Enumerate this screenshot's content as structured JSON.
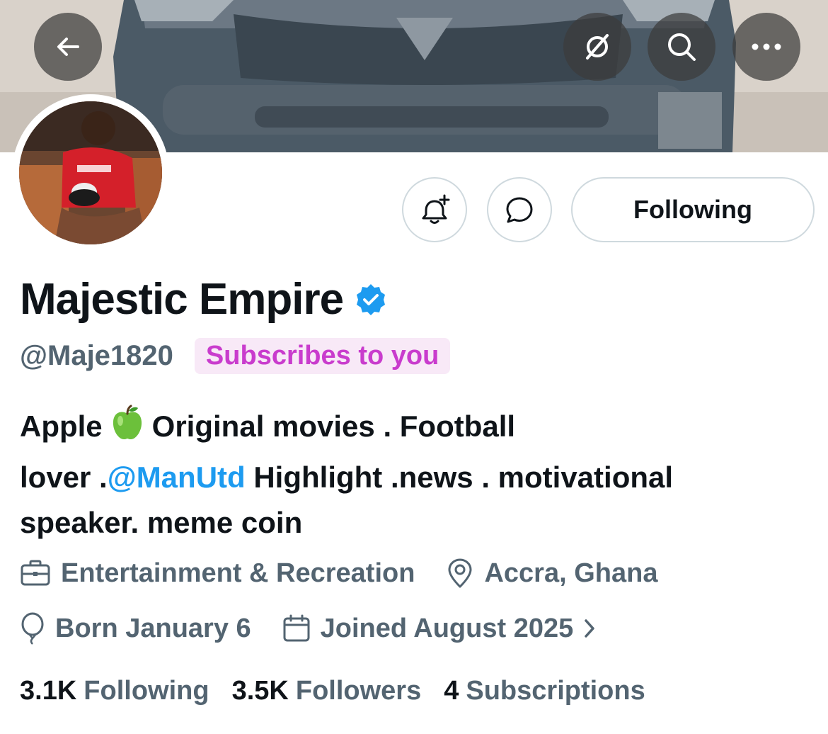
{
  "header": {
    "back_icon": "arrow-left-icon",
    "grok_icon": "grok-slash-icon",
    "search_icon": "search-icon",
    "more_icon": "more-horizontal-icon"
  },
  "actions": {
    "notify_icon": "bell-plus-icon",
    "message_icon": "message-bubble-icon",
    "following_label": "Following"
  },
  "profile": {
    "display_name": "Majestic Empire",
    "verified_icon": "verified-badge-icon",
    "handle": "@Maje1820",
    "subscribes_badge": "Subscribes to you"
  },
  "bio": {
    "part1": "Apple",
    "emoji": "green-apple-emoji",
    "part2": "Original movies . Football",
    "part3": "lover .",
    "mention": "@ManUtd",
    "part4": " Highlight .news . motivational",
    "part5": "speaker. meme coin"
  },
  "meta": {
    "category": "Entertainment & Recreation",
    "location": "Accra, Ghana",
    "birthday": "Born January 6",
    "joined": "Joined August 2025"
  },
  "stats": {
    "following_count": "3.1K",
    "following_label": "Following",
    "followers_count": "3.5K",
    "followers_label": "Followers",
    "subscriptions_count": "4",
    "subscriptions_label": "Subscriptions"
  },
  "colors": {
    "accent": "#1d9bf0",
    "secondary_text": "#536471",
    "subscribes_text": "#c93ccd",
    "subscribes_bg": "#f8e9f7"
  }
}
